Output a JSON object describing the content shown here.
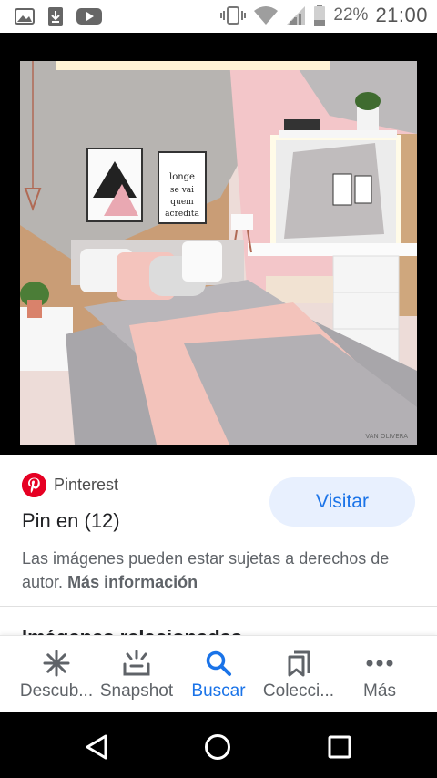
{
  "status_bar": {
    "battery_percent": "22%",
    "time": "21:00",
    "icons": [
      "gallery-icon",
      "download-icon",
      "youtube-icon",
      "vibrate-icon",
      "wifi-icon",
      "signal-icon",
      "battery-icon"
    ]
  },
  "result": {
    "source": "Pinterest",
    "title": "Pin en (12)",
    "visit_label": "Visitar",
    "copyright_text": "Las imágenes pueden estar sujetas a derechos de autor.",
    "more_info_label": "Más información",
    "related_heading": "Imágenes relacionadas",
    "image_caption": "VAN OLIVERA",
    "poster_text": "longe se vai quem acredita"
  },
  "bottom_nav": {
    "items": [
      {
        "label": "Descub...",
        "icon": "asterisk-icon"
      },
      {
        "label": "Snapshot",
        "icon": "snapshot-icon"
      },
      {
        "label": "Buscar",
        "icon": "search-icon"
      },
      {
        "label": "Colecci...",
        "icon": "collections-icon"
      },
      {
        "label": "Más",
        "icon": "more-icon"
      }
    ],
    "active_index": 2
  },
  "colors": {
    "accent": "#1a73e8",
    "pinterest_red": "#e60023",
    "visit_bg": "#e8f0fe"
  }
}
